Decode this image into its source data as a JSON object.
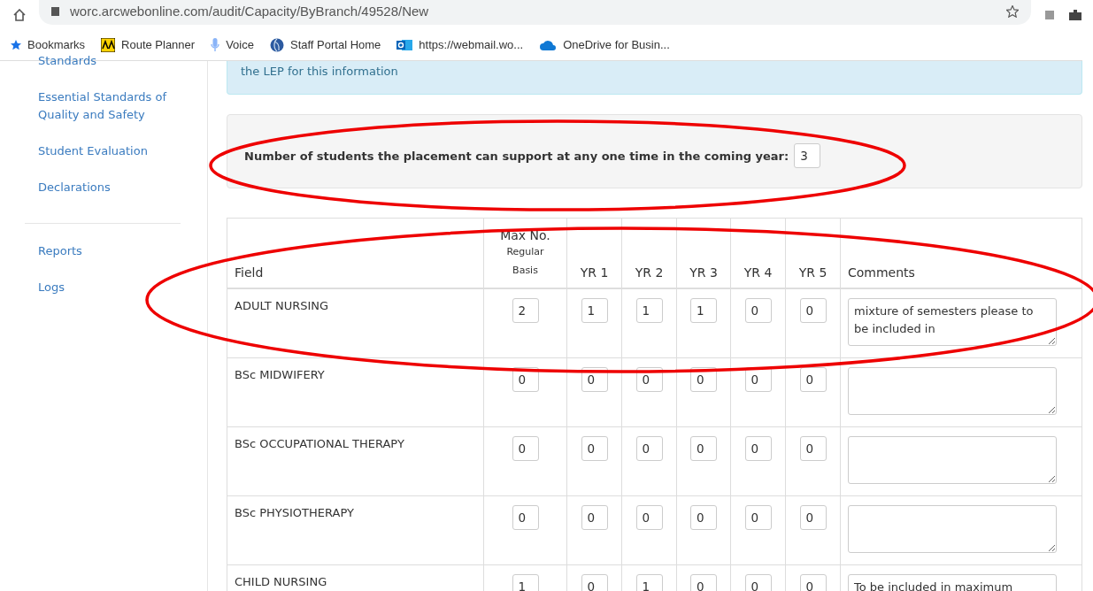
{
  "browser": {
    "url": "worc.arcwebonline.com/audit/Capacity/ByBranch/49528/New",
    "bookmarks": [
      {
        "label": "Bookmarks",
        "kind": "star"
      },
      {
        "label": "Route Planner",
        "kind": "aa"
      },
      {
        "label": "Voice",
        "kind": "mic"
      },
      {
        "label": "Staff Portal Home",
        "kind": "globe"
      },
      {
        "label": "https://webmail.wo...",
        "kind": "mail"
      },
      {
        "label": "OneDrive for Busin...",
        "kind": "cloud"
      }
    ]
  },
  "sidebar": {
    "primary_items": [
      {
        "label": "Standards"
      },
      {
        "label": "Essential Standards of Quality and Safety"
      },
      {
        "label": "Student Evaluation"
      },
      {
        "label": "Declarations"
      }
    ],
    "secondary_items": [
      {
        "label": "Reports"
      },
      {
        "label": "Logs"
      }
    ]
  },
  "info_text": "the LEP for this information",
  "capacity": {
    "label": "Number of students the placement can support at any one time in the coming year:",
    "value": "3"
  },
  "table": {
    "columns": [
      {
        "label": "Field"
      },
      {
        "label": "Max No.",
        "sublabel": "Regular Basis"
      },
      {
        "label": "YR 1"
      },
      {
        "label": "YR 2"
      },
      {
        "label": "YR 3"
      },
      {
        "label": "YR 4"
      },
      {
        "label": "YR 5"
      },
      {
        "label": "Comments"
      }
    ],
    "rows": [
      {
        "field": "ADULT NURSING",
        "values": [
          "2",
          "1",
          "1",
          "1",
          "0",
          "0"
        ],
        "comment": "mixture of semesters please to be included in"
      },
      {
        "field": "BSc MIDWIFERY",
        "values": [
          "0",
          "0",
          "0",
          "0",
          "0",
          "0"
        ]
      },
      {
        "field": "BSc OCCUPATIONAL THERAPY",
        "values": [
          "0",
          "0",
          "0",
          "0",
          "0",
          "0"
        ]
      },
      {
        "field": "BSc PHYSIOTHERAPY",
        "values": [
          "0",
          "0",
          "0",
          "0",
          "0",
          "0"
        ]
      },
      {
        "field": "CHILD NURSING",
        "values": [
          "1",
          "0",
          "1",
          "0",
          "0",
          "0"
        ],
        "comment": "To be included in maximum"
      }
    ]
  }
}
